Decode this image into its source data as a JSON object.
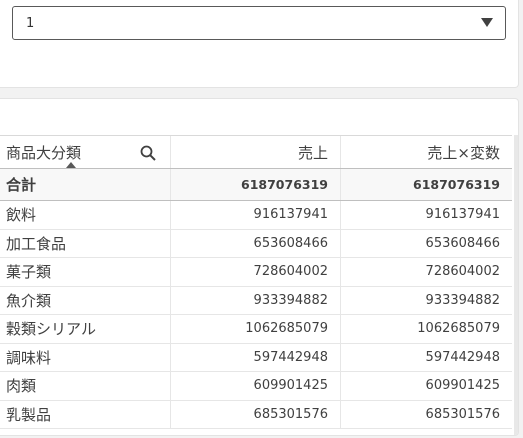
{
  "selector": {
    "value": "1"
  },
  "table": {
    "columns": [
      "商品大分類",
      "売上",
      "売上×変数"
    ],
    "total": {
      "label": "合計",
      "values": [
        "6187076319",
        "6187076319"
      ]
    },
    "rows": [
      {
        "category": "飲料",
        "sales": "916137941",
        "sales_x_var": "916137941"
      },
      {
        "category": "加工食品",
        "sales": "653608466",
        "sales_x_var": "653608466"
      },
      {
        "category": "菓子類",
        "sales": "728604002",
        "sales_x_var": "728604002"
      },
      {
        "category": "魚介類",
        "sales": "933394882",
        "sales_x_var": "933394882"
      },
      {
        "category": "穀類シリアル",
        "sales": "1062685079",
        "sales_x_var": "1062685079"
      },
      {
        "category": "調味料",
        "sales": "597442948",
        "sales_x_var": "597442948"
      },
      {
        "category": "肉類",
        "sales": "609901425",
        "sales_x_var": "609901425"
      },
      {
        "category": "乳製品",
        "sales": "685301576",
        "sales_x_var": "685301576"
      }
    ]
  },
  "icons": {
    "search": "search-icon",
    "dropdown": "chevron-down-icon",
    "sort": "sort-caret-icon"
  }
}
